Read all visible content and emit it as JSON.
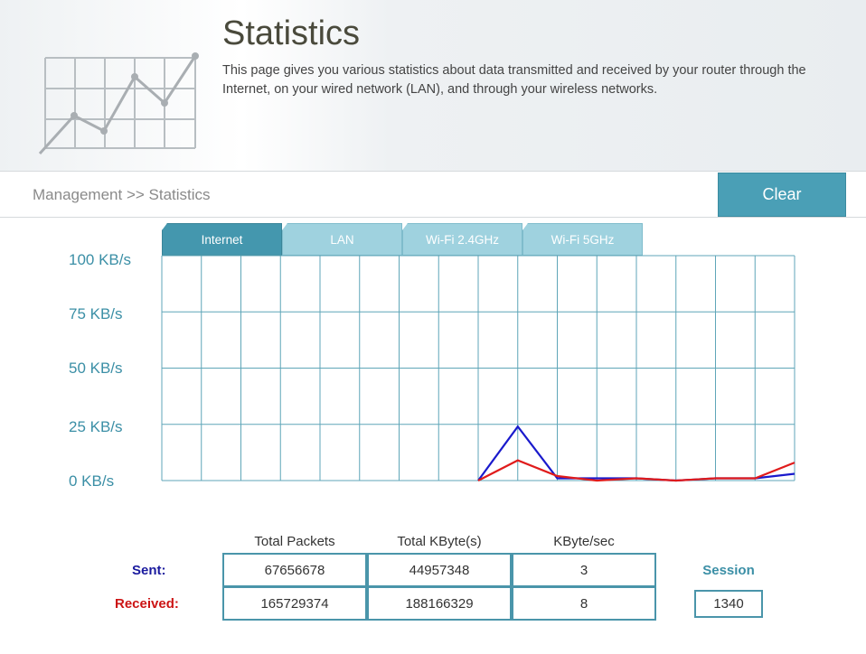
{
  "header": {
    "title": "Statistics",
    "description": "This page gives you various statistics about data transmitted and received by your router through the Internet, on your wired network (LAN), and through your wireless networks."
  },
  "breadcrumb": "Management >> Statistics",
  "clear_label": "Clear",
  "tabs": [
    {
      "label": "Internet",
      "active": true
    },
    {
      "label": "LAN",
      "active": false
    },
    {
      "label": "Wi-Fi 2.4GHz",
      "active": false
    },
    {
      "label": "Wi-Fi 5GHz",
      "active": false
    }
  ],
  "colors": {
    "accent": "#4a9fb6",
    "sent": "#1a1acc",
    "received": "#e01b1b",
    "grid": "#5fa6b8"
  },
  "chart_data": {
    "type": "line",
    "y_ticks": [
      "100 KB/s",
      "75 KB/s",
      "50 KB/s",
      "25 KB/s",
      "0 KB/s"
    ],
    "ylim": [
      0,
      100
    ],
    "x_points": 17,
    "series": [
      {
        "name": "Sent",
        "color": "#1a1acc",
        "values": [
          null,
          null,
          null,
          null,
          null,
          null,
          null,
          null,
          0,
          24,
          1,
          1,
          1,
          0,
          1,
          1,
          3
        ]
      },
      {
        "name": "Received",
        "color": "#e01b1b",
        "values": [
          null,
          null,
          null,
          null,
          null,
          null,
          null,
          null,
          0,
          9,
          2,
          0,
          1,
          0,
          1,
          1,
          8
        ]
      }
    ]
  },
  "stats": {
    "columns": [
      "Total Packets",
      "Total KByte(s)",
      "KByte/sec"
    ],
    "rows": [
      {
        "label": "Sent:",
        "values": [
          "67656678",
          "44957348",
          "3"
        ]
      },
      {
        "label": "Received:",
        "values": [
          "165729374",
          "188166329",
          "8"
        ]
      }
    ],
    "session_label": "Session",
    "session_value": "1340"
  }
}
